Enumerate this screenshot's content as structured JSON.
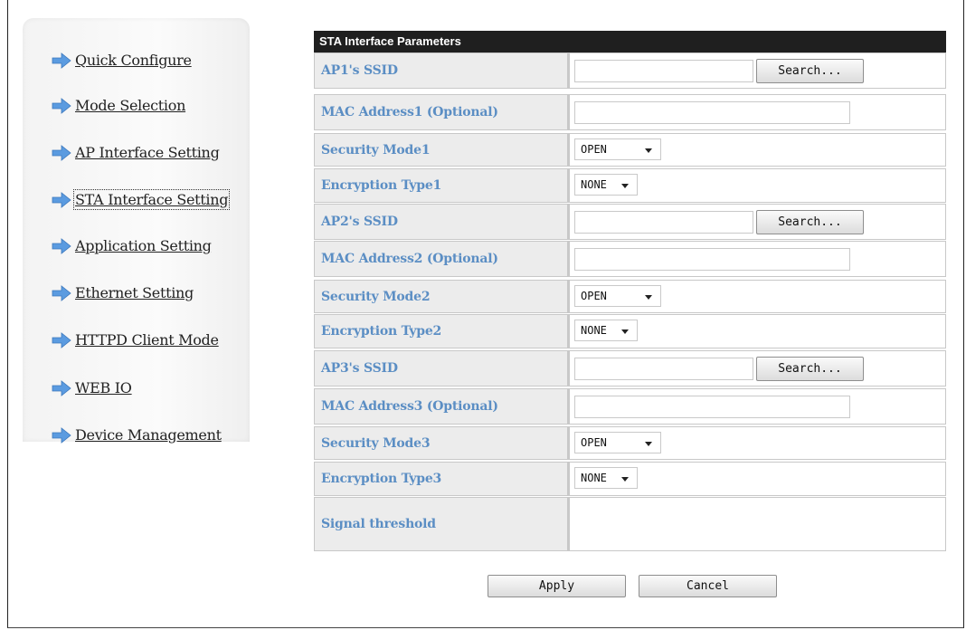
{
  "sidebar": {
    "items": [
      {
        "label": "Quick Configure"
      },
      {
        "label": "Mode Selection"
      },
      {
        "label": "AP Interface Setting"
      },
      {
        "label": "STA Interface Setting"
      },
      {
        "label": "Application Setting"
      },
      {
        "label": "Ethernet Setting"
      },
      {
        "label": "HTTPD Client Mode"
      },
      {
        "label": "WEB IO"
      },
      {
        "label": "Device Management"
      }
    ],
    "active_index": 3
  },
  "table": {
    "header": "STA Interface Parameters",
    "rows": [
      {
        "label": "AP1's SSID",
        "kind": "ssid",
        "value": "",
        "search_label": "Search..."
      },
      {
        "label": "MAC Address1 (Optional)",
        "kind": "text",
        "value": ""
      },
      {
        "label": "Security Mode1",
        "kind": "select",
        "value": "OPEN"
      },
      {
        "label": "Encryption Type1",
        "kind": "select-sm",
        "value": "NONE"
      },
      {
        "label": "AP2's SSID",
        "kind": "ssid",
        "value": "",
        "search_label": "Search..."
      },
      {
        "label": "MAC Address2 (Optional)",
        "kind": "text",
        "value": ""
      },
      {
        "label": "Security Mode2",
        "kind": "select",
        "value": "OPEN"
      },
      {
        "label": "Encryption Type2",
        "kind": "select-sm",
        "value": "NONE"
      },
      {
        "label": "AP3's SSID",
        "kind": "ssid",
        "value": "",
        "search_label": "Search..."
      },
      {
        "label": "MAC Address3 (Optional)",
        "kind": "text",
        "value": ""
      },
      {
        "label": "Security Mode3",
        "kind": "select",
        "value": "OPEN"
      },
      {
        "label": "Encryption Type3",
        "kind": "select-sm",
        "value": "NONE"
      },
      {
        "label": "Signal threshold",
        "kind": "empty",
        "value": ""
      }
    ]
  },
  "actions": {
    "apply_label": "Apply",
    "cancel_label": "Cancel"
  },
  "colors": {
    "label_text": "#5b8ec4",
    "header_bg": "#1f1f1f",
    "label_bg": "#ececec",
    "icon_blue": "#5b9be0"
  }
}
